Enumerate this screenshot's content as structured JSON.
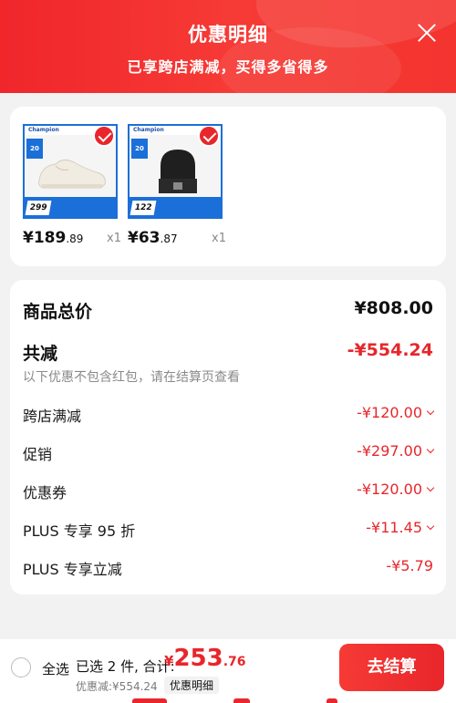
{
  "header": {
    "title": "优惠明细",
    "subtitle": "已享跨店满减，买得多省得多",
    "close_icon": "close-icon"
  },
  "products": [
    {
      "name": "shoe",
      "price_int": "¥189",
      "price_dec": ".89",
      "qty": "x1",
      "thumb_price": "299",
      "brand": "Champion",
      "promo": "20"
    },
    {
      "name": "beanie",
      "price_int": "¥63",
      "price_dec": ".87",
      "qty": "x1",
      "thumb_price": "122",
      "brand": "Champion",
      "promo": "20"
    }
  ],
  "summary": {
    "total_label": "商品总价",
    "total_value": "¥808.00",
    "reduce_label": "共减",
    "reduce_value": "-¥554.24",
    "note": "以下优惠不包含红包，请在结算页查看",
    "items": [
      {
        "label": "跨店满减",
        "value": "-¥120.00"
      },
      {
        "label": "促销",
        "value": "-¥297.00"
      },
      {
        "label": "优惠券",
        "value": "-¥120.00"
      },
      {
        "label": "PLUS 专享 95 折",
        "value": "-¥11.45"
      },
      {
        "label": "PLUS 专享立减",
        "value": "-¥5.79"
      }
    ]
  },
  "bottom": {
    "select_all": "全选",
    "selected": "已选 2 件, 合计:",
    "yen": "¥",
    "amount": "253",
    "amount_dec": ".76",
    "discount": "优惠减:¥554.24",
    "detail_link": "优惠明细",
    "checkout": "去结算"
  },
  "colors": {
    "accent": "#e8262b",
    "header": "#f0262b",
    "thumb_border": "#1b6fd8"
  }
}
